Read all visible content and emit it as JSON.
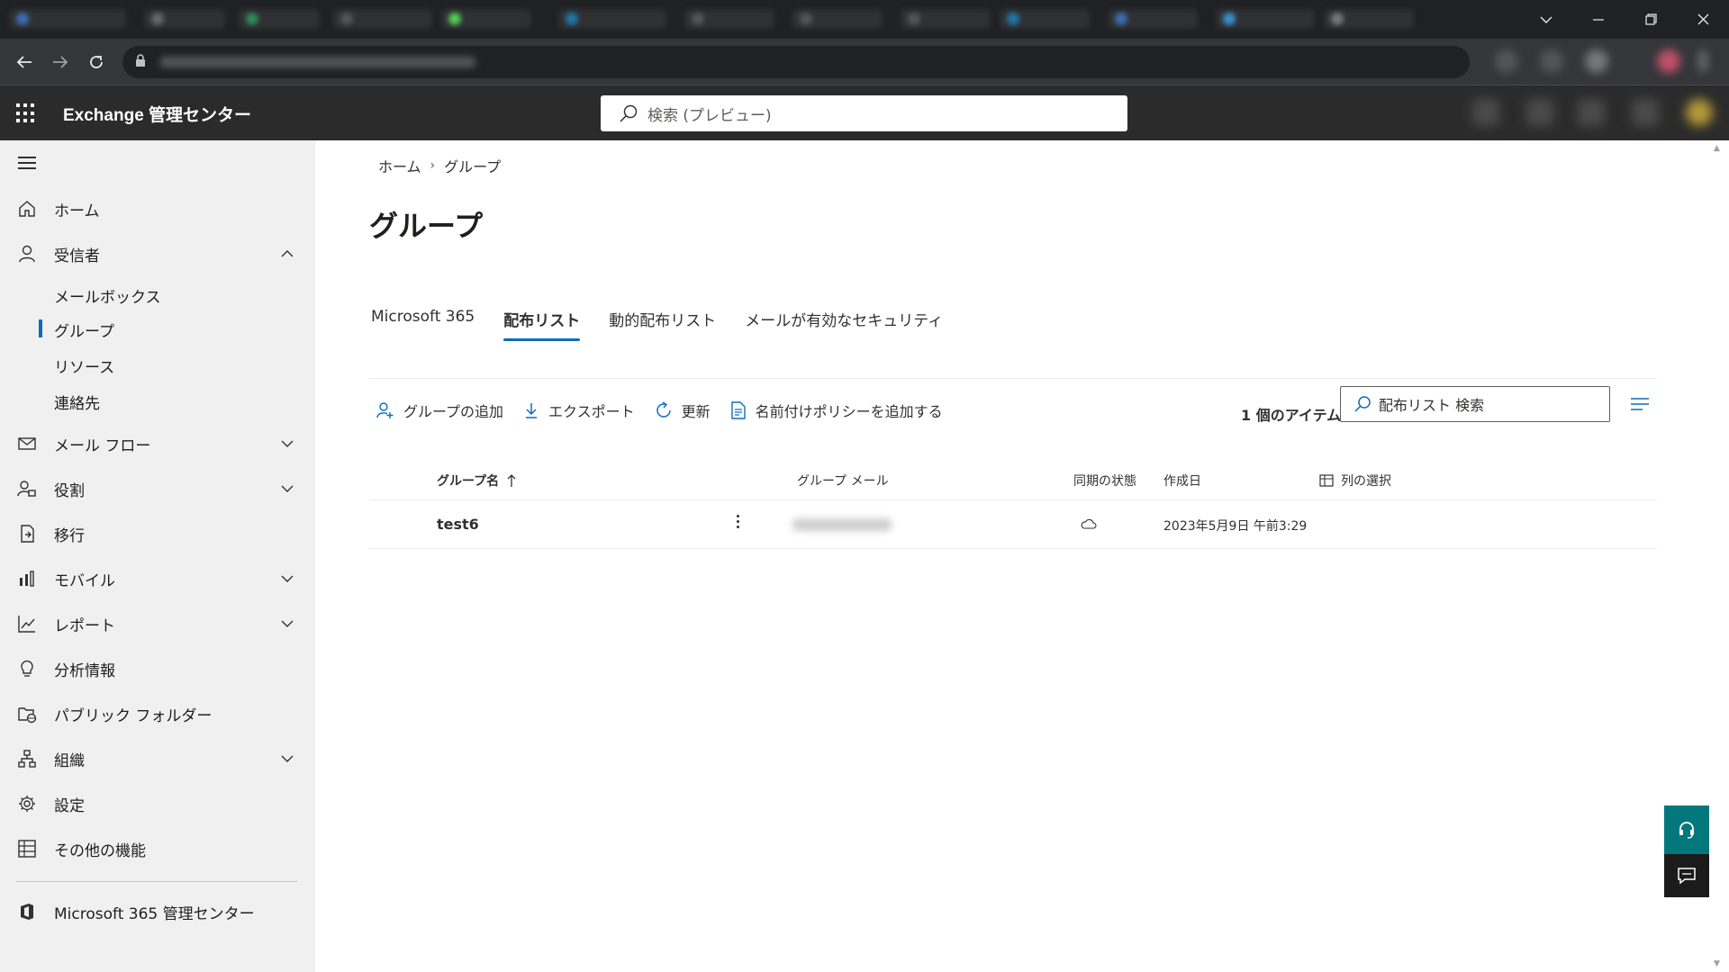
{
  "browser": {
    "window_controls": [
      "chevron-down",
      "minimize",
      "maximize",
      "close"
    ]
  },
  "app": {
    "title": "Exchange 管理センター",
    "search_placeholder": "検索 (プレビュー)"
  },
  "sidebar": {
    "items": [
      {
        "label": "ホーム",
        "icon": "home-icon",
        "expandable": false
      },
      {
        "label": "受信者",
        "icon": "person-icon",
        "expandable": true,
        "expanded": true
      },
      {
        "label": "メール フロー",
        "icon": "mail-icon",
        "expandable": true
      },
      {
        "label": "役割",
        "icon": "roles-icon",
        "expandable": true
      },
      {
        "label": "移行",
        "icon": "migration-icon",
        "expandable": false
      },
      {
        "label": "モバイル",
        "icon": "mobile-icon",
        "expandable": true
      },
      {
        "label": "レポート",
        "icon": "chart-icon",
        "expandable": true
      },
      {
        "label": "分析情報",
        "icon": "lightbulb-icon",
        "expandable": false
      },
      {
        "label": "パブリック フォルダー",
        "icon": "public-folder-icon",
        "expandable": false
      },
      {
        "label": "組織",
        "icon": "org-icon",
        "expandable": true
      },
      {
        "label": "設定",
        "icon": "gear-icon",
        "expandable": false
      },
      {
        "label": "その他の機能",
        "icon": "table-icon",
        "expandable": false
      }
    ],
    "recipients_sub": [
      "メールボックス",
      "グループ",
      "リソース",
      "連絡先"
    ],
    "active_sub": "グループ",
    "footer_link": "Microsoft 365 管理センター"
  },
  "breadcrumb": {
    "home": "ホーム",
    "current": "グループ"
  },
  "page_title": "グループ",
  "tabs": [
    "Microsoft 365",
    "配布リスト",
    "動的配布リスト",
    "メールが有効なセキュリティ"
  ],
  "active_tab": "配布リスト",
  "commands": {
    "add": "グループの追加",
    "export": "エクスポート",
    "refresh": "更新",
    "naming_policy": "名前付けポリシーを追加する"
  },
  "item_count": "1 個のアイテム",
  "list_search_placeholder": "配布リスト 検索",
  "table": {
    "columns": {
      "name": "グループ名",
      "email": "グループ メール",
      "sync": "同期の状態",
      "created": "作成日",
      "choose_columns": "列の選択"
    },
    "rows": [
      {
        "name": "test6",
        "sync_icon": "cloud-icon",
        "created": "2023年5月9日 午前3:29"
      }
    ]
  },
  "colors": {
    "accent": "#0f6cbd",
    "header_bg": "#2b2b2b",
    "nav_bg": "#f0f0f0",
    "help_button": "#03787c"
  }
}
